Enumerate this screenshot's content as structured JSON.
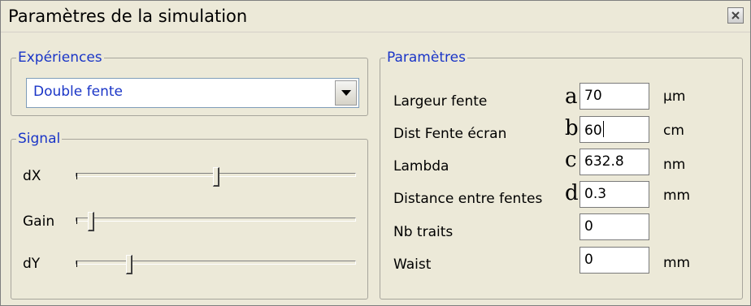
{
  "window": {
    "title": "Paramètres de la simulation"
  },
  "experiences": {
    "legend": "Expériences",
    "select_value": "Double fente"
  },
  "signal": {
    "legend": "Signal",
    "sliders": [
      {
        "label": "dX",
        "level": 0.48
      },
      {
        "label": "Gain",
        "level": 0.02
      },
      {
        "label": "dY",
        "level": 0.16
      }
    ]
  },
  "parametres": {
    "legend": "Paramètres",
    "rows": [
      {
        "label": "Largeur fente",
        "marker": "a",
        "value": "70",
        "unit": "µm"
      },
      {
        "label": "Dist Fente écran",
        "marker": "b",
        "value": "60",
        "unit": "cm"
      },
      {
        "label": "Lambda",
        "marker": "c",
        "value": "632.8",
        "unit": "nm"
      },
      {
        "label": "Distance entre fentes",
        "marker": "d",
        "value": "0.3",
        "unit": "mm"
      },
      {
        "label": "Nb traits",
        "marker": "",
        "value": "0",
        "unit": ""
      },
      {
        "label": "Waist",
        "marker": "",
        "value": "0",
        "unit": "mm"
      }
    ]
  }
}
